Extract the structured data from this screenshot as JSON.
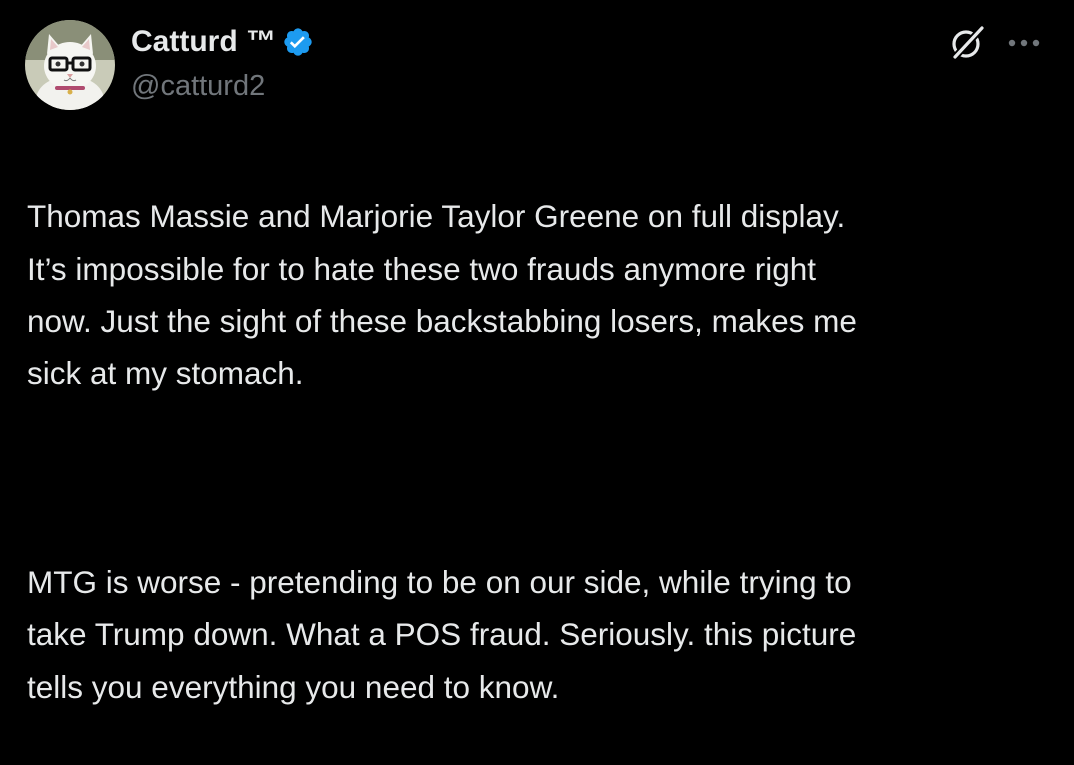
{
  "author": {
    "display_name": "Catturd ™",
    "handle": "@catturd2",
    "verified": true,
    "avatar_icon": "cat-with-glasses-avatar"
  },
  "actions": {
    "grok_icon": "grok-icon",
    "more_icon": "more-dots-icon"
  },
  "tweet": {
    "paragraph_1": "Thomas Massie and Marjorie Taylor Greene on full display.\nIt’s impossible for to hate these two frauds anymore right\nnow. Just the sight of these backstabbing losers, makes me\nsick at my stomach.",
    "paragraph_2": "MTG is worse - pretending to be on our side, while trying to\ntake Trump down. What a POS fraud. Seriously. this picture\ntells you everything you need to know."
  },
  "colors": {
    "background": "#000000",
    "text_primary": "#e7e9ea",
    "text_secondary": "#71767b",
    "verified_blue": "#1d9bf0"
  }
}
